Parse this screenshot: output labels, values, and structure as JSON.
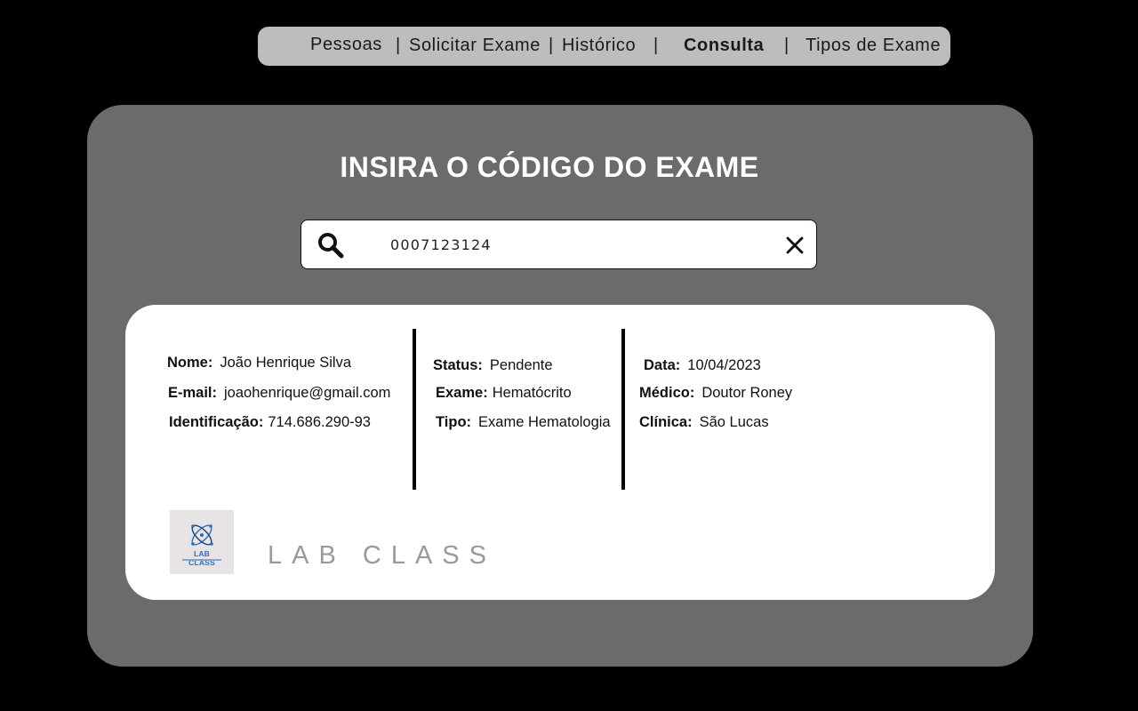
{
  "nav": {
    "items": [
      {
        "label": "Pessoas"
      },
      {
        "label": "Solicitar Exame"
      },
      {
        "label": "Histórico"
      },
      {
        "label": "Consulta"
      },
      {
        "label": "Tipos de Exame"
      }
    ],
    "separator": "|",
    "active": "Consulta"
  },
  "panel": {
    "title": "INSIRA O CÓDIGO DO EXAME"
  },
  "search": {
    "value": "0007123124"
  },
  "result": {
    "col1": {
      "nome_label": "Nome:",
      "nome_value": "João Henrique Silva",
      "email_label": "E-mail:",
      "email_value": "joaohenrique@gmail.com",
      "id_label": "Identificação:",
      "id_value": "714.686.290-93"
    },
    "col2": {
      "status_label": "Status:",
      "status_value": "Pendente",
      "exame_label": "Exame:",
      "exame_value": "Hematócrito",
      "tipo_label": "Tipo:",
      "tipo_value": "Exame Hematologia"
    },
    "col3": {
      "data_label": "Data:",
      "data_value": "10/04/2023",
      "medico_label": "Médico:",
      "medico_value": "Doutor Roney",
      "clinica_label": "Clínica:",
      "clinica_value": "São Lucas"
    }
  },
  "brand": {
    "logo_text": "LAB CLASS",
    "name": "LAB CLASS"
  },
  "colors": {
    "background": "#000000",
    "navbar": "#bdbdbd",
    "panel": "#6b6b6b",
    "card": "#ffffff",
    "brand_text": "#9a9a9a",
    "logo_accent": "#2d6fb8"
  }
}
